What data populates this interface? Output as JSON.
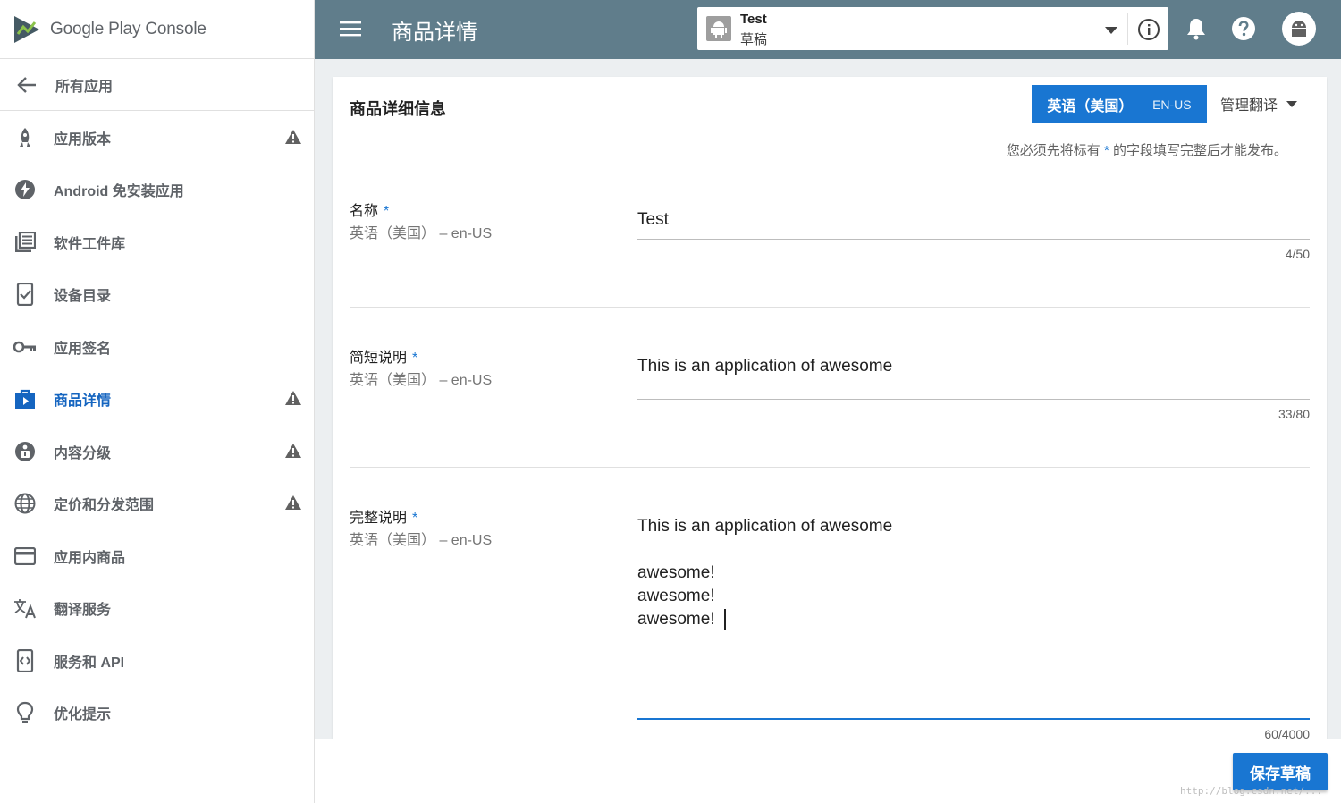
{
  "brand": {
    "google": "Google Play",
    "console": "Console"
  },
  "sidebar": {
    "back_label": "所有应用",
    "items": [
      {
        "label": "应用版本",
        "icon": "rocket-icon",
        "warning": true
      },
      {
        "label": "Android 免安装应用",
        "icon": "bolt-icon",
        "warning": false
      },
      {
        "label": "软件工件库",
        "icon": "library-icon",
        "warning": false
      },
      {
        "label": "设备目录",
        "icon": "device-check-icon",
        "warning": false
      },
      {
        "label": "应用签名",
        "icon": "key-icon",
        "warning": false
      },
      {
        "label": "商品详情",
        "icon": "shop-icon",
        "warning": true,
        "active": true
      },
      {
        "label": "内容分级",
        "icon": "rating-icon",
        "warning": true
      },
      {
        "label": "定价和分发范围",
        "icon": "globe-icon",
        "warning": true
      },
      {
        "label": "应用内商品",
        "icon": "card-icon",
        "warning": false
      },
      {
        "label": "翻译服务",
        "icon": "translate-icon",
        "warning": false
      },
      {
        "label": "服务和 API",
        "icon": "api-icon",
        "warning": false
      },
      {
        "label": "优化提示",
        "icon": "lightbulb-icon",
        "warning": false
      }
    ]
  },
  "topbar": {
    "title": "商品详情",
    "app_name": "Test",
    "app_status": "草稿"
  },
  "card": {
    "title": "商品详细信息",
    "lang_main": "英语（美国）",
    "lang_sub": "– EN-US",
    "manage_label": "管理翻译",
    "note_before": "您必须先将标有",
    "note_star": "*",
    "note_after": "的字段填写完整后才能发布。"
  },
  "fields": [
    {
      "label": "名称",
      "sub": "英语（美国） – en-US",
      "value": "Test",
      "count": "4/50"
    },
    {
      "label": "简短说明",
      "sub": "英语（美国） – en-US",
      "value": "This is an application of awesome",
      "count": "33/80"
    },
    {
      "label": "完整说明",
      "sub": "英语（美国） – en-US",
      "value": "This is an application of awesome\n\nawesome!\nawesome!\nawesome!",
      "count": "60/4000"
    }
  ],
  "footer": {
    "save_label": "保存草稿"
  },
  "watermark": "http://blog.csdn.net/...",
  "colors": {
    "accent": "#1976d2",
    "topbar": "#607d8b",
    "warning": "#616161"
  }
}
